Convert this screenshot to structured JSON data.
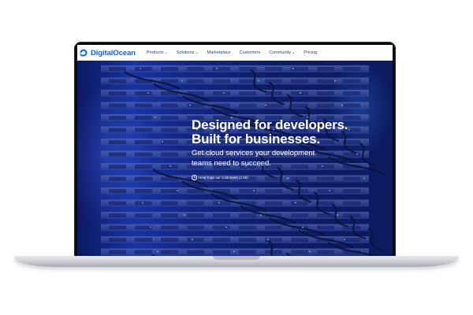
{
  "nav": {
    "logo_text": "DigitalOcean",
    "items": [
      {
        "label": "Products",
        "dropdown": true
      },
      {
        "label": "Solutions",
        "dropdown": true
      },
      {
        "label": "Marketplace",
        "dropdown": false
      },
      {
        "label": "Customers",
        "dropdown": false
      },
      {
        "label": "Community",
        "dropdown": true
      },
      {
        "label": "Pricing",
        "dropdown": false
      }
    ]
  },
  "hero": {
    "headline_line1": "Designed for developers.",
    "headline_line2": "Built for businesses.",
    "subhead_line1": "Get cloud services your development",
    "subhead_line2": "teams need to succeed.",
    "video_link": "Hear from our customers (1:56)"
  },
  "colors": {
    "brand": "#0069ff",
    "hero_bg": "#13288a",
    "nav_text": "#2a3b8f"
  }
}
